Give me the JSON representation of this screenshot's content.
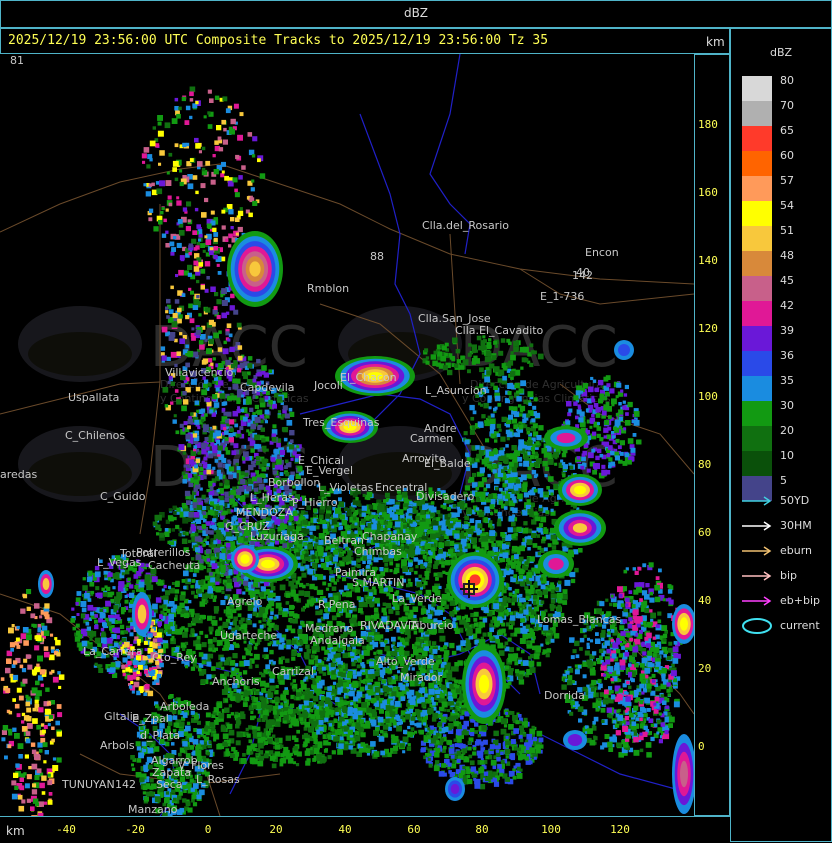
{
  "window": {
    "title": "dBZ"
  },
  "header": {
    "text": "2025/12/19 23:56:00 UTC Composite Tracks to 2025/12/19 23:56:00 Tz 35",
    "unit_top": "km",
    "unit_bottom": "km"
  },
  "y_axis": {
    "labels": [
      "180",
      "160",
      "140",
      "120",
      "100",
      "80",
      "60",
      "40",
      "20",
      "0"
    ]
  },
  "x_axis": {
    "labels": [
      "-40",
      "-20",
      "0",
      "20",
      "40",
      "60",
      "80",
      "100",
      "120"
    ]
  },
  "legend": {
    "title": "dBZ",
    "levels": [
      {
        "label": "80",
        "color": "#d8d8d8"
      },
      {
        "label": "70",
        "color": "#b0b0b0"
      },
      {
        "label": "65",
        "color": "#ff3a2a"
      },
      {
        "label": "60",
        "color": "#ff6400"
      },
      {
        "label": "57",
        "color": "#ff9a5a"
      },
      {
        "label": "54",
        "color": "#ffff00"
      },
      {
        "label": "51",
        "color": "#f8c83c"
      },
      {
        "label": "48",
        "color": "#d8893a"
      },
      {
        "label": "45",
        "color": "#c8608a"
      },
      {
        "label": "42",
        "color": "#e01896"
      },
      {
        "label": "39",
        "color": "#6a18d8"
      },
      {
        "label": "36",
        "color": "#2a4ae8"
      },
      {
        "label": "35",
        "color": "#1a8ce0"
      },
      {
        "label": "30",
        "color": "#129a12"
      },
      {
        "label": "20",
        "color": "#107010"
      },
      {
        "label": "10",
        "color": "#0a500a"
      },
      {
        "label": "5",
        "color": "#44448a"
      }
    ],
    "tracks": [
      {
        "label": "50YD",
        "color": "#40d0e0"
      },
      {
        "label": "30HM",
        "color": "#ffffff"
      },
      {
        "label": "eburn",
        "color": "#f0c070"
      },
      {
        "label": "bip",
        "color": "#ffc0c0"
      },
      {
        "label": "eb+bip",
        "color": "#ff40ff"
      },
      {
        "label": "current",
        "color": "#40e0f0"
      }
    ]
  },
  "map": {
    "watermark": {
      "logo_text": "DACC",
      "sub1": "Dirección de Agricultura",
      "sub2": "y Contingencias Climáticas",
      "fragment1": "Dirección de Agric",
      "fragment2": "y Contingencias Climáticas",
      "fragment3": "Dirección de Agri",
      "fragment4": "y Contingencias"
    },
    "places": [
      "Clla.del_Rosario",
      "Encon",
      "142",
      "E_1-736",
      "Rmblon",
      "Clla.San_Jose",
      "Clla.El_Cavadito",
      "Villavicencio",
      "Capdevila",
      "Uspallata",
      "El_Chacon",
      "L_Asuncion",
      "C_Chilenos",
      "Tres_Esquinas",
      "Jocoli",
      "Andre",
      "Carmen",
      "Arroyito",
      "El_Balde",
      "E_Chical",
      "E_Vergel",
      "aredas",
      "Borbollon",
      "L_Violetas",
      "Encentral",
      "Divisadero",
      "C_Guido",
      "L_Heras",
      "P_Hierro",
      "MENDOZA",
      "G_CRUZ",
      "Luzuriaga",
      "Chapanay",
      "Beltran",
      "Chimbas",
      "Potrerillos",
      "Cacheuta",
      "L_Vegas",
      "Palmira",
      "S.MARTIN",
      "Agrelo",
      "R.Pena",
      "La_Verde",
      "Lomas_Blancas",
      "Ugarteche",
      "La_Carrera",
      "Cto_Rey",
      "Medrano",
      "Anchoris",
      "RIVADAVIA",
      "Andalgala",
      "Alto_Verde",
      "Carrizal",
      "Tiburcio",
      "Mirador",
      "Dorrida",
      "Gltalia",
      "E_Zpal",
      "Arboleda",
      "Arbols",
      "d_Plata",
      "Algarrob",
      "Zapata",
      "Seca",
      "L_Rosas",
      "TUNUYAN",
      "Manzano",
      "V_Flores",
      "Totoral",
      "88",
      "40",
      "142",
      "81"
    ]
  }
}
